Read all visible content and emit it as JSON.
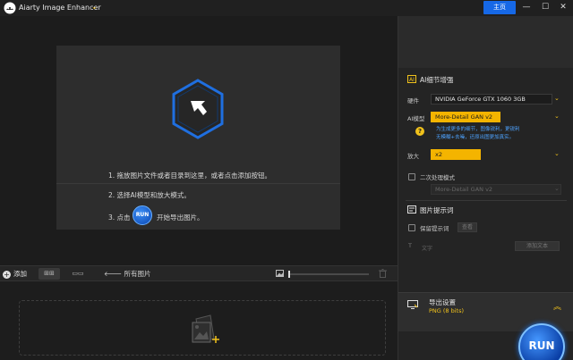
{
  "app": {
    "title": "Aiarty Image Enhancer",
    "home_label": "主页",
    "colors": {
      "accent": "#1668e6",
      "highlight": "#f4b400",
      "link": "#4ea3ff"
    }
  },
  "window_controls": {
    "minimize": "—",
    "maximize": "☐",
    "close": "✕"
  },
  "instructions": {
    "step1": "1. 拖放图片文件或者目录到这里，或者点击添加按钮。",
    "step2": "2. 选择AI模型和放大模式。",
    "step3_prefix": "3. 点击",
    "run_inline": "RUN",
    "step3_suffix": "开始导出图片。"
  },
  "thumb_toolbar": {
    "add_label": "添加",
    "all_images_label": "所有图片",
    "view_grid_glyph": "⊞⊞",
    "view_strip_glyph": "▭▭",
    "zoom": 0.0
  },
  "panel": {
    "ai_section_title": "AI细节增强",
    "hardware_label": "硬件",
    "hardware_value": "NVIDIA GeForce GTX 1060 3GB",
    "model_label": "AI模型",
    "model_value": "More-Detail GAN v2",
    "model_note_1": "为生成更多的细节，图像锐利，更锐利",
    "model_note_2": "无模糊+去噪，还原出图更加真实。",
    "upscale_label": "放大",
    "upscale_value": "x2",
    "secondary_label": "二次处理模式",
    "secondary_value": "More-Detail GAN v2",
    "tips_section_title": "图片提示词",
    "keep_tips_label": "保留提示词",
    "view_button": "查看",
    "text_placeholder": "文字",
    "add_text_button": "添加文本",
    "export_title": "导出设置",
    "export_format": "PNG  (8 bits)",
    "run_label": "RUN"
  }
}
